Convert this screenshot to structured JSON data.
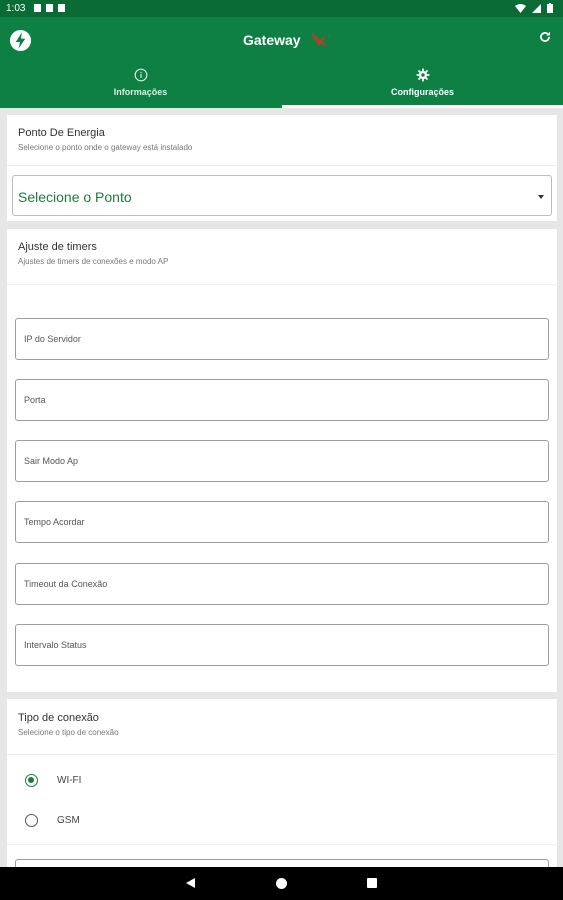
{
  "status_bar": {
    "time": "1:03"
  },
  "app_bar": {
    "title": "Gateway"
  },
  "tabs": [
    {
      "label": "Informações",
      "icon": "info-icon"
    },
    {
      "label": "Configurações",
      "icon": "gear-icon"
    }
  ],
  "energy_point": {
    "title": "Ponto De Energia",
    "subtitle": "Selecione o ponto onde o gateway está instalado",
    "select_value": "Selecione o Ponto"
  },
  "timers": {
    "title": "Ajuste de timers",
    "subtitle": "Ajustes de timers de conexões e modo AP",
    "fields": [
      {
        "label": "IP do Servidor"
      },
      {
        "label": "Porta"
      },
      {
        "label": "Sair Modo Ap"
      },
      {
        "label": "Tempo Acordar"
      },
      {
        "label": "Timeout da Conexão"
      },
      {
        "label": "Intervalo Status"
      }
    ]
  },
  "connection": {
    "title": "Tipo de conexão",
    "subtitle": "Selecione o tipo de conexão",
    "options": [
      {
        "label": "WI-FI",
        "selected": true
      },
      {
        "label": "GSM",
        "selected": false
      }
    ]
  },
  "colors": {
    "primary": "#0e8043",
    "status": "#0b6b36",
    "accent": "#1e7a3e"
  }
}
